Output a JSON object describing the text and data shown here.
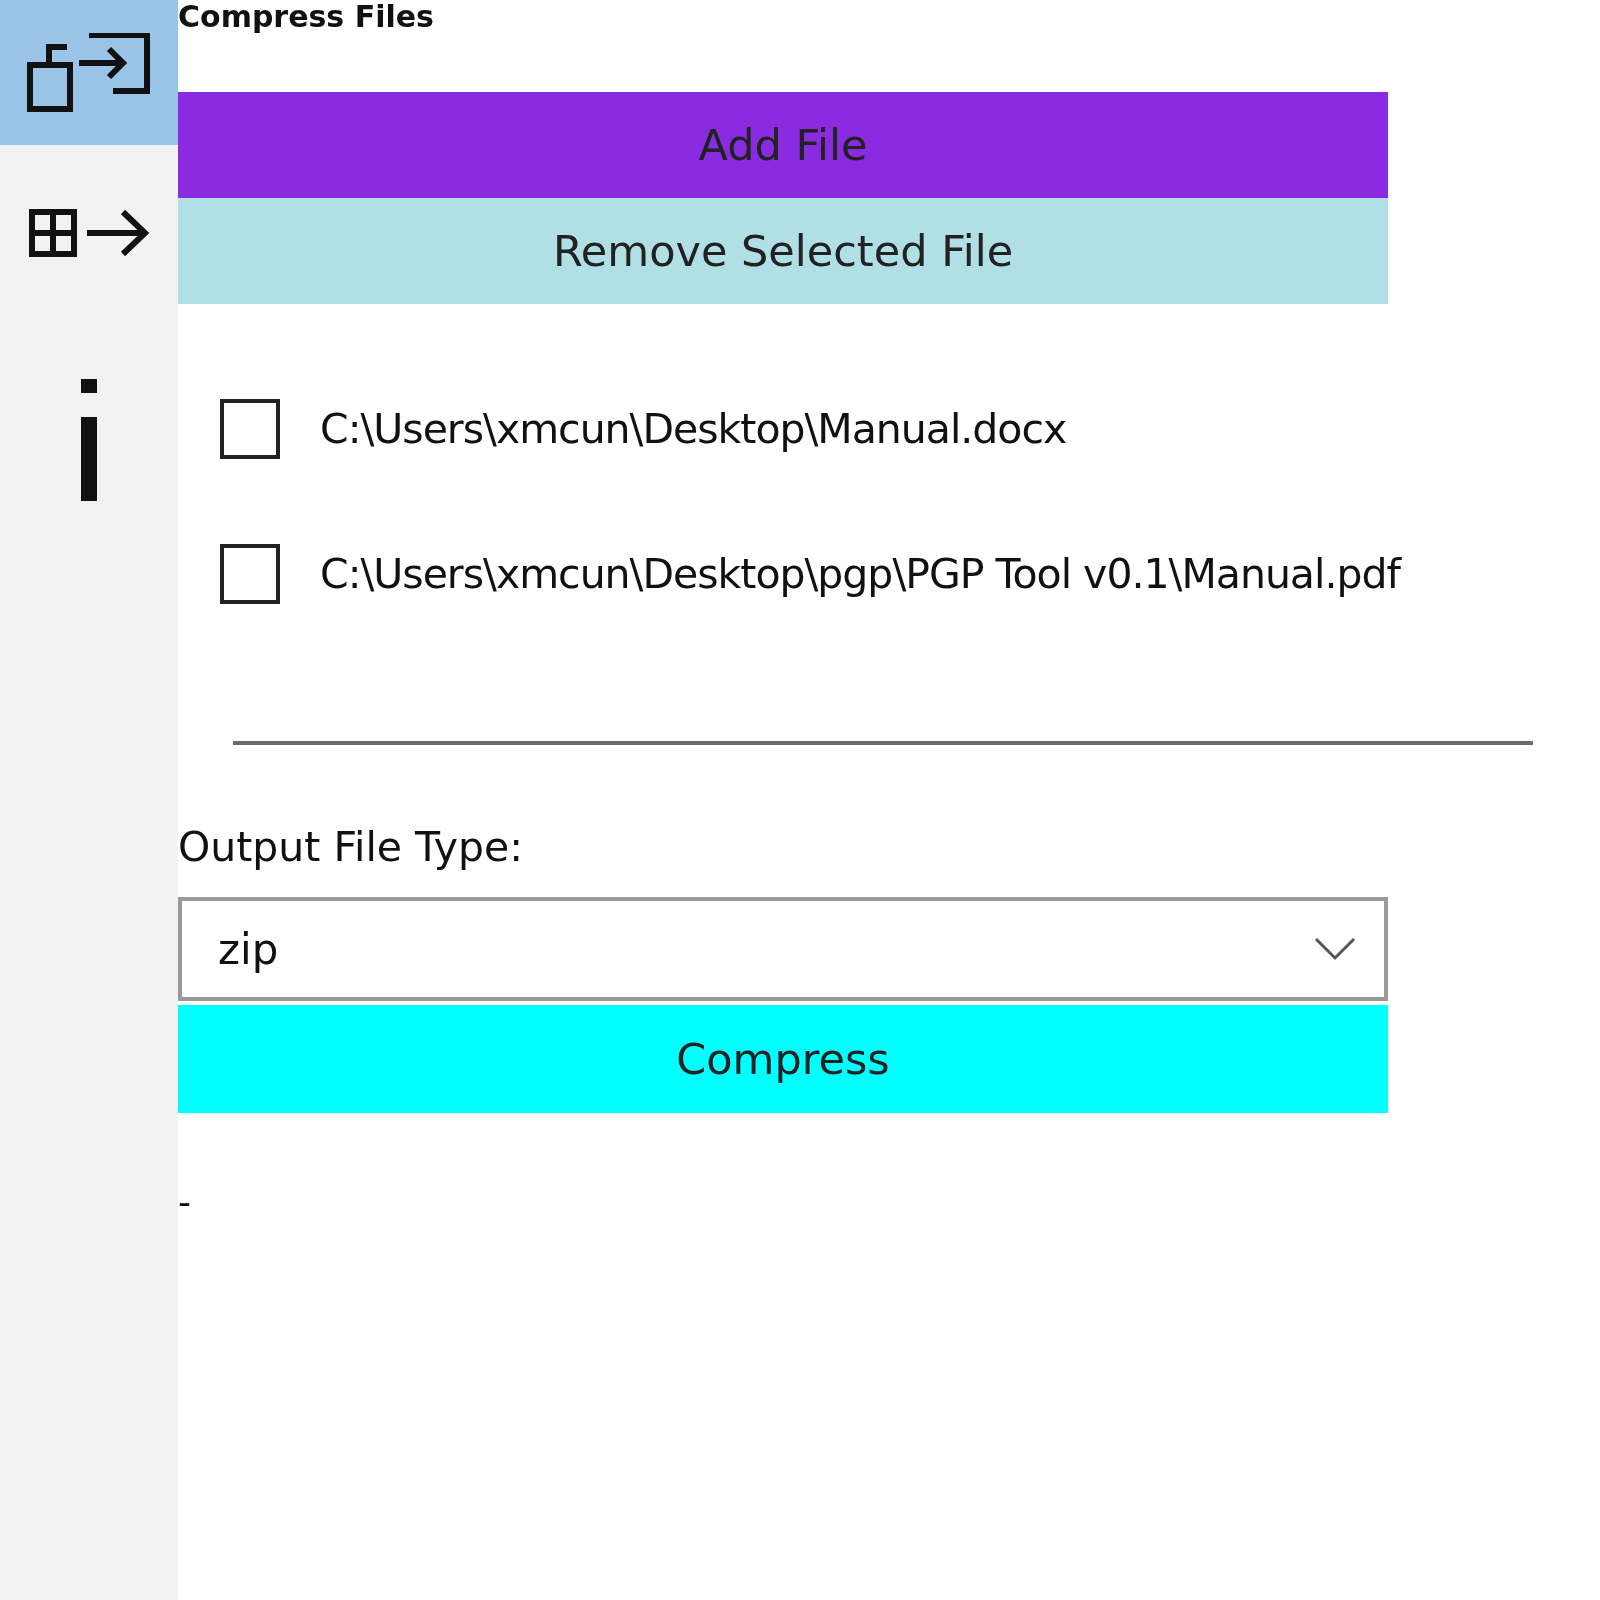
{
  "title": "Compress Files",
  "nav": [
    {
      "kind": "compress",
      "selected": true
    },
    {
      "kind": "extract",
      "selected": false
    },
    {
      "kind": "info",
      "selected": false
    }
  ],
  "add_button": "Add File",
  "remove_button": "Remove Selected File",
  "files": [
    {
      "path": "C:\\Users\\xmcun\\Desktop\\Manual.docx",
      "checked": false
    },
    {
      "path": "C:\\Users\\xmcun\\Desktop\\pgp\\PGP Tool v0.1\\Manual.pdf",
      "checked": false
    }
  ],
  "output_label": "Output File Type:",
  "output_type": "zip",
  "compress_button": "Compress",
  "status": "-"
}
